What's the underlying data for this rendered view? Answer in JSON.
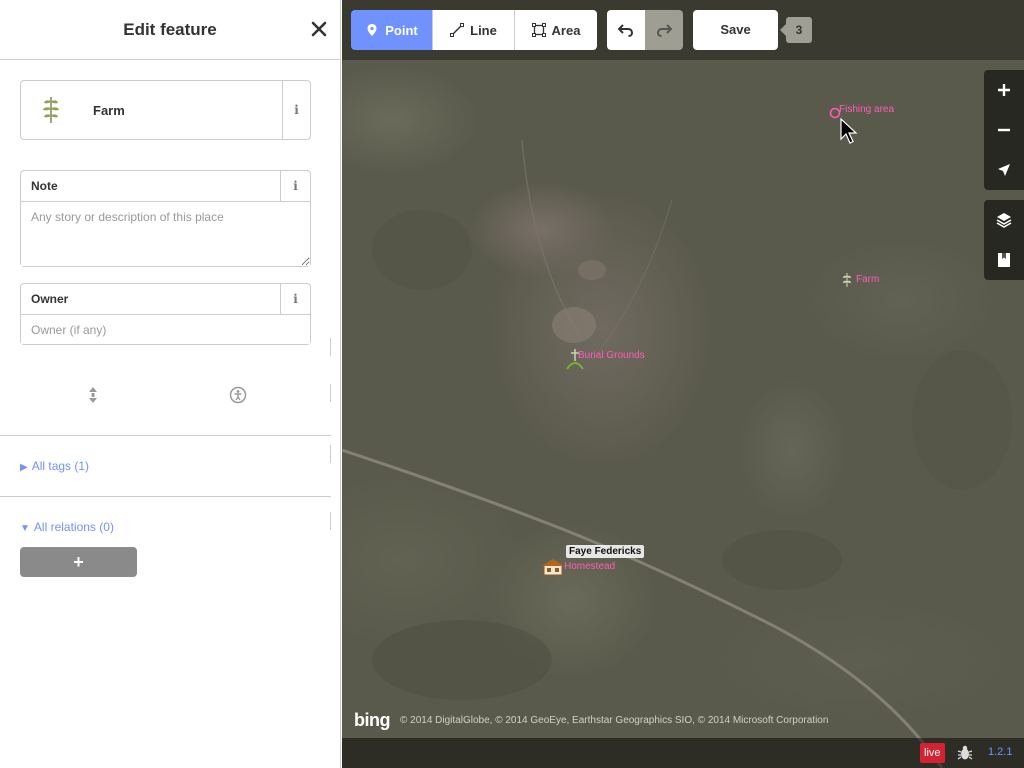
{
  "sidebar": {
    "title": "Edit feature",
    "preset": {
      "name": "Farm",
      "icon": "farm-plant-icon"
    },
    "fields": {
      "note": {
        "label": "Note",
        "placeholder": "Any story or description of this place",
        "value": ""
      },
      "owner": {
        "label": "Owner",
        "placeholder": "Owner (if any)",
        "value": ""
      }
    },
    "all_tags": {
      "label": "All tags (1)",
      "expanded": false
    },
    "all_relations": {
      "label": "All relations (0)",
      "expanded": true
    },
    "add_relation_label": "+"
  },
  "toolbar": {
    "modes": [
      {
        "label": "Point",
        "icon": "point-marker-icon",
        "active": true
      },
      {
        "label": "Line",
        "icon": "line-icon",
        "active": false
      },
      {
        "label": "Area",
        "icon": "area-icon",
        "active": false
      }
    ],
    "save_label": "Save",
    "save_count": "3"
  },
  "map": {
    "labels": {
      "fishing_area": "Fishing area",
      "farm": "Farm",
      "burial_grounds": "Burial Grounds",
      "faye_federicks": "Faye Federicks",
      "homestead": "Homestead"
    },
    "bing_logo": "bing",
    "attribution": "© 2014 DigitalGlobe, © 2014 GeoEye, Earthstar Geographics SIO, © 2014 Microsoft Corporation"
  },
  "footer": {
    "live": "live",
    "version": "1.2.1"
  },
  "colors": {
    "accent": "#7092ff",
    "label_pink": "#ff5cb7",
    "live_red": "#d32232"
  }
}
